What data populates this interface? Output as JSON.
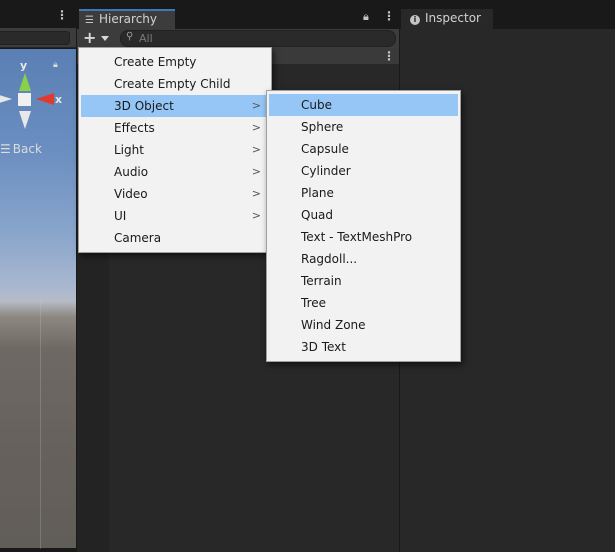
{
  "scene": {
    "gizmo_y": "y",
    "gizmo_x": "x",
    "back_label": "Back"
  },
  "hierarchy": {
    "tab_title": "Hierarchy",
    "search_placeholder": "All"
  },
  "inspector": {
    "tab_title": "Inspector"
  },
  "menu_main": {
    "items": [
      {
        "label": "Create Empty"
      },
      {
        "label": "Create Empty Child"
      },
      {
        "label": "3D Object"
      },
      {
        "label": "Effects"
      },
      {
        "label": "Light"
      },
      {
        "label": "Audio"
      },
      {
        "label": "Video"
      },
      {
        "label": "UI"
      },
      {
        "label": "Camera"
      }
    ]
  },
  "menu_sub": {
    "items": [
      {
        "label": "Cube"
      },
      {
        "label": "Sphere"
      },
      {
        "label": "Capsule"
      },
      {
        "label": "Cylinder"
      },
      {
        "label": "Plane"
      },
      {
        "label": "Quad"
      },
      {
        "label": "Text - TextMeshPro"
      },
      {
        "label": "Ragdoll..."
      },
      {
        "label": "Terrain"
      },
      {
        "label": "Tree"
      },
      {
        "label": "Wind Zone"
      },
      {
        "label": "3D Text"
      }
    ]
  },
  "colors": {
    "highlight": "#96c6f5",
    "tab_accent": "#3a79bb",
    "panel_bg": "#282828",
    "menu_bg": "#f2f2f2"
  }
}
